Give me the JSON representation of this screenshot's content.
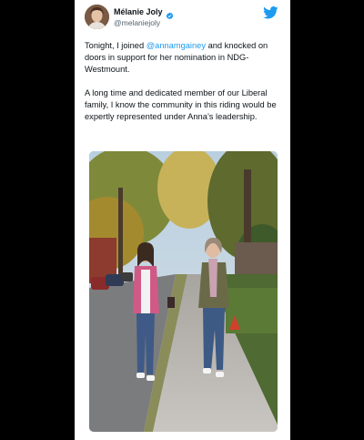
{
  "tweet": {
    "author": {
      "display_name": "Mélanie Joly",
      "handle": "@melaniejoly",
      "verified": true,
      "verified_icon": "verified-badge-icon",
      "avatar_icon": "avatar"
    },
    "platform_icon": "twitter-bird-icon",
    "text": {
      "p1_before": "Tonight, I joined ",
      "p1_mention": "@annamgainey",
      "p1_after": " and knocked on doors in support for her nomination in NDG-Westmount.",
      "p2": "A long time and dedicated member of our Liberal family, I know the community in this riding would be expertly represented under Anna’s leadership."
    },
    "media": {
      "type": "photo",
      "icon": "photo-two-women-walking"
    }
  },
  "colors": {
    "background": "#000000",
    "card": "#ffffff",
    "text": "#0f1419",
    "secondary_text": "#536471",
    "accent": "#1d9bf0"
  }
}
